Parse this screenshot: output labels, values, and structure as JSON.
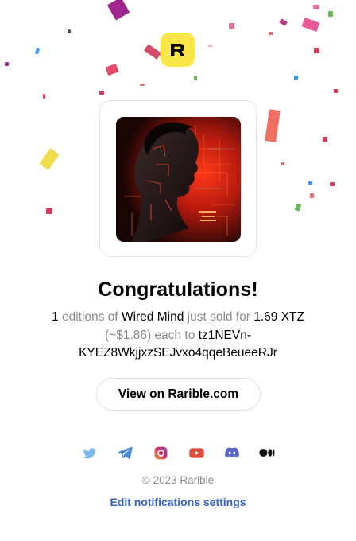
{
  "brand": {
    "logo_letter": "R",
    "logo_color": "#fbe64a"
  },
  "nft": {
    "image_caption": "Wired Mind artwork"
  },
  "heading": {
    "title": "Congratulations!"
  },
  "message": {
    "count": "1",
    "editions_of": "editions of",
    "item_name": "Wired Mind",
    "just_sold_for": "just sold for",
    "price": "1.69 XTZ",
    "usd": "(~$1.86)",
    "each_to": "each to",
    "buyer": "tz1NEVn-KYEZ8WkjjxzSEJvxo4qqeBeueeRJr"
  },
  "cta": {
    "label": "View on Rarible.com"
  },
  "socials": [
    {
      "name": "twitter-icon",
      "color": "#7ab7ea"
    },
    {
      "name": "telegram-icon",
      "color": "#4a8ad0"
    },
    {
      "name": "instagram-icon",
      "color": "#b35ac6"
    },
    {
      "name": "youtube-icon",
      "color": "#e04a3a"
    },
    {
      "name": "discord-icon",
      "color": "#5865c8"
    },
    {
      "name": "medium-icon",
      "color": "#111111"
    }
  ],
  "footer": {
    "copyright": "© 2023 Rarible",
    "settings_link": "Edit notifications settings",
    "link_color": "#3462c8"
  }
}
